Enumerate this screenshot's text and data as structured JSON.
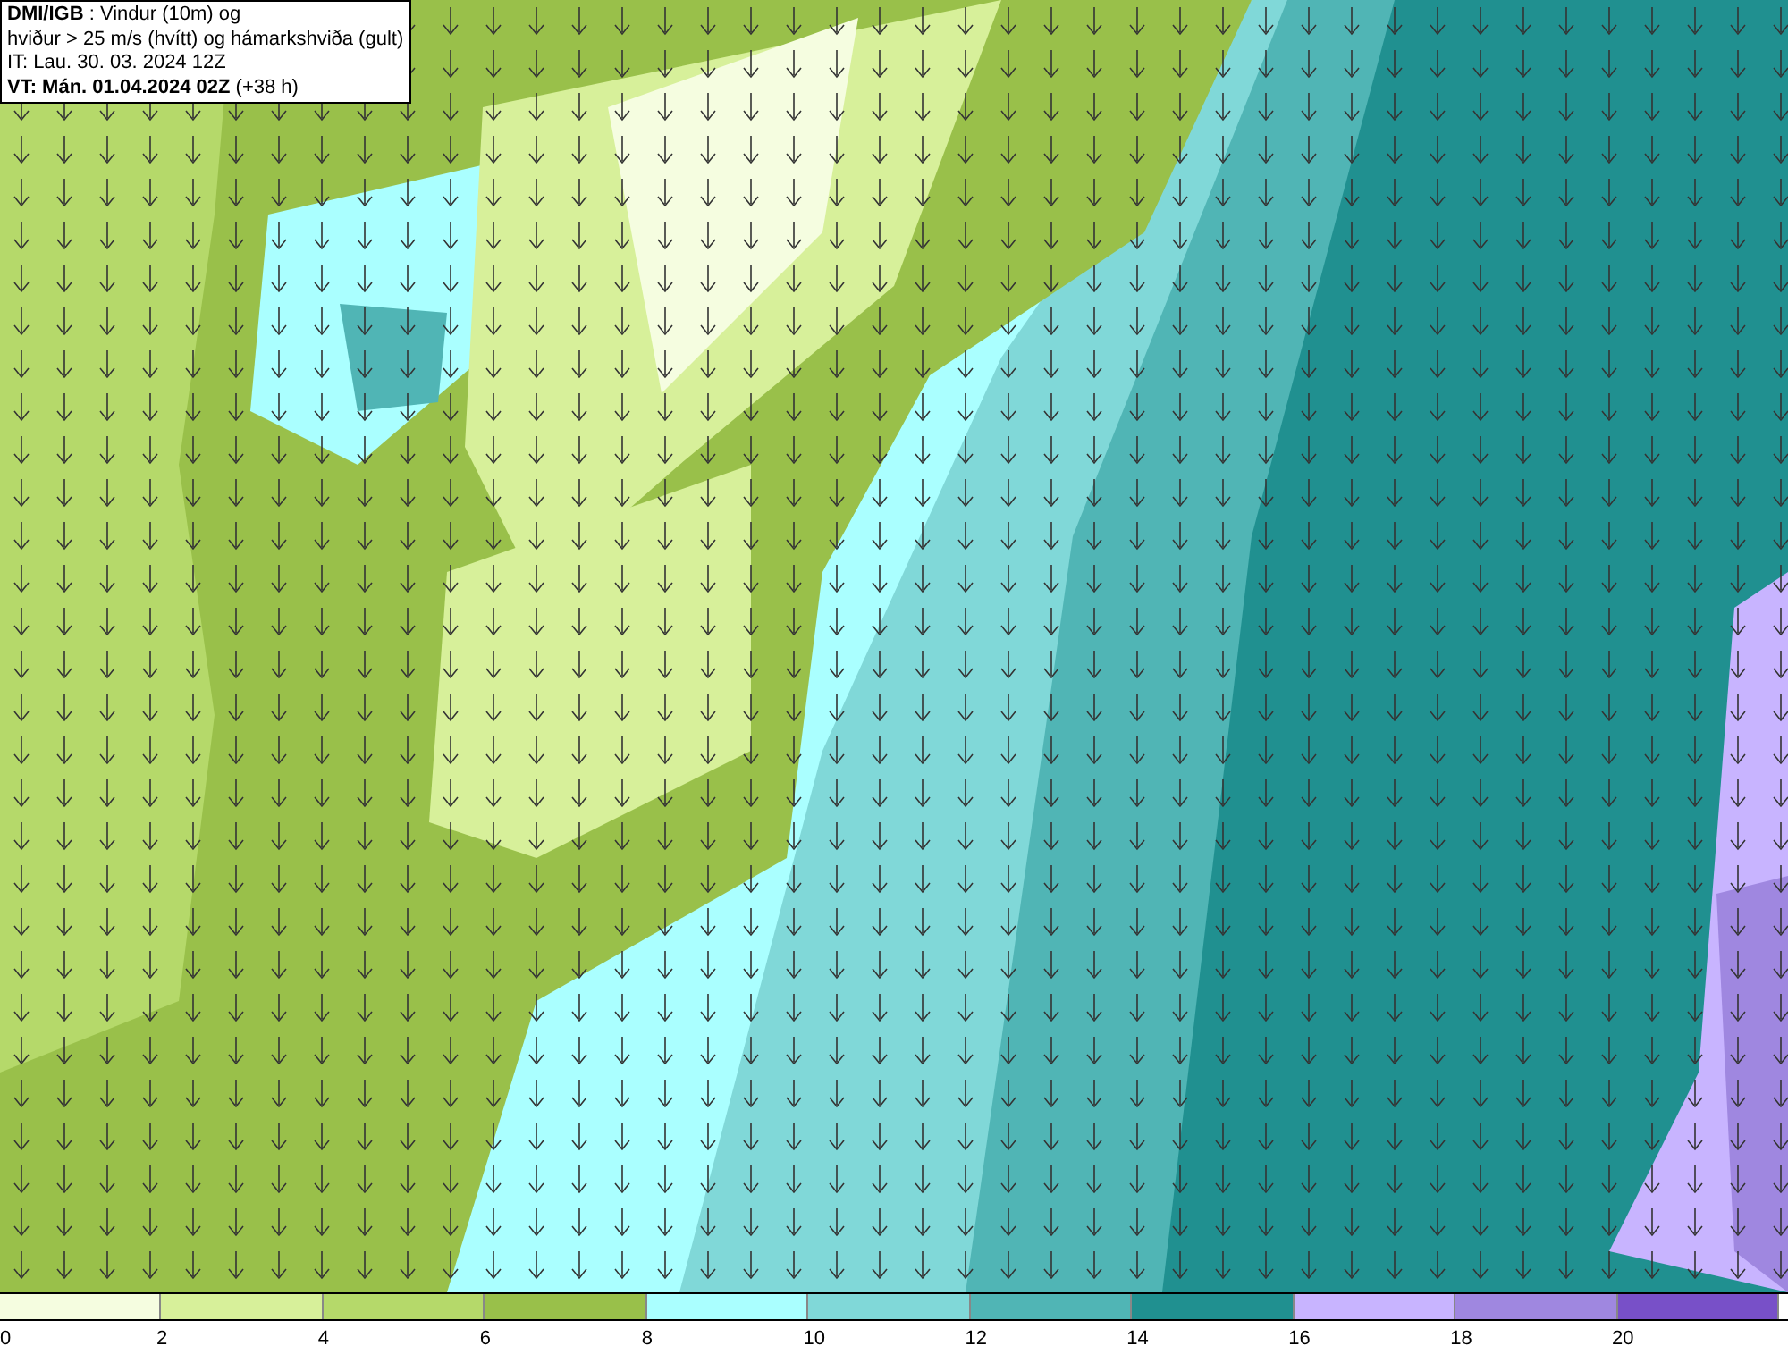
{
  "title_box": {
    "lines": [
      "**DMI/IGB** : Vindur (10m) og",
      "hviður > 25 m/s (hvítt) og hámarkshviða (gult)",
      "IT: Lau. 30. 03. 2024 12Z",
      "**VT: Mán. 01.04.2024 02Z** (+38 h)"
    ]
  },
  "legend": {
    "bins": [
      {
        "color": "#f5fde0",
        "label": "0"
      },
      {
        "color": "#d7f09a",
        "label": "2"
      },
      {
        "color": "#b5d96a",
        "label": "4"
      },
      {
        "color": "#99c04a",
        "label": "6"
      },
      {
        "color": "#aaffff",
        "label": "8"
      },
      {
        "color": "#80d8d8",
        "label": "10"
      },
      {
        "color": "#50b5b5",
        "label": "12"
      },
      {
        "color": "#209090",
        "label": "14"
      },
      {
        "color": "#c8b4ff",
        "label": "16"
      },
      {
        "color": "#9f87e0",
        "label": "18"
      },
      {
        "color": "#7850c8",
        "label": "20"
      }
    ]
  }
}
